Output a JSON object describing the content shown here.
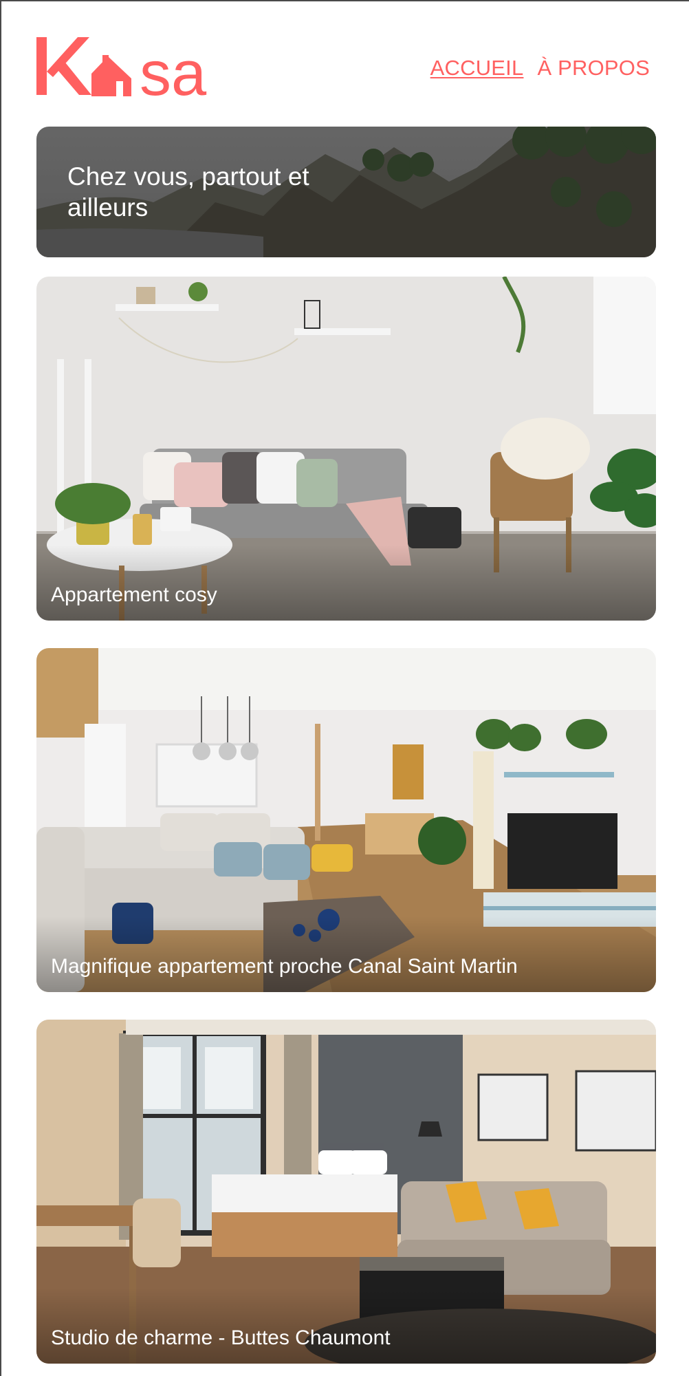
{
  "brand": {
    "letters_before": "K",
    "letters_after": "sa",
    "color": "#ff6060",
    "icon": "house-icon"
  },
  "nav": {
    "items": [
      {
        "label": "ACCUEIL",
        "active": true
      },
      {
        "label": "À PROPOS",
        "active": false
      }
    ]
  },
  "banner": {
    "title": "Chez vous, partout et ailleurs"
  },
  "listings": [
    {
      "title": "Appartement cosy"
    },
    {
      "title": "Magnifique appartement proche Canal Saint Martin"
    },
    {
      "title": "Studio de charme - Buttes Chaumont"
    }
  ]
}
